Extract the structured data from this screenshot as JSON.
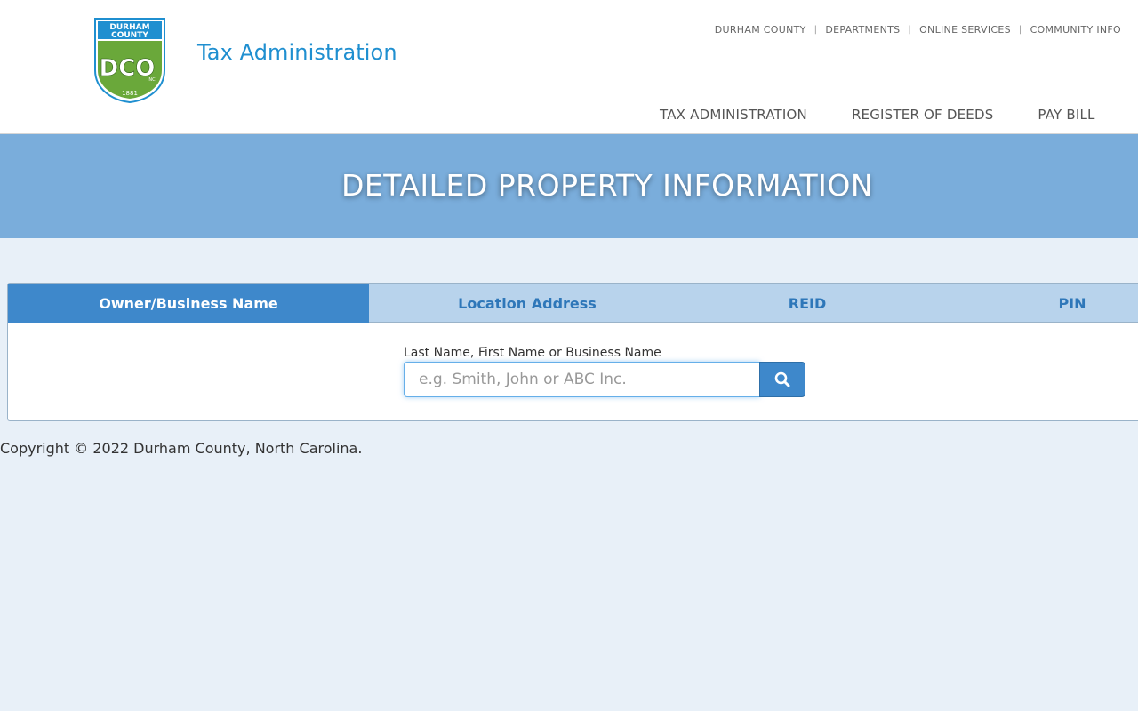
{
  "logo": {
    "county_text_line1": "DURHAM",
    "county_text_line2": "COUNTY",
    "monogram": "DCO",
    "state_abbrev": "NC",
    "year": "1881"
  },
  "site_title": "Tax Administration",
  "utility_nav": [
    "DURHAM COUNTY",
    "DEPARTMENTS",
    "ONLINE SERVICES",
    "COMMUNITY INFO"
  ],
  "main_nav": [
    "TAX ADMINISTRATION",
    "REGISTER OF DEEDS",
    "PAY BILL"
  ],
  "banner_title": "DETAILED PROPERTY INFORMATION",
  "tabs": [
    {
      "label": "Owner/Business Name",
      "active": true
    },
    {
      "label": "Location Address",
      "active": false
    },
    {
      "label": "REID",
      "active": false
    },
    {
      "label": "PIN",
      "active": false
    }
  ],
  "search": {
    "label": "Last Name, First Name or Business Name",
    "placeholder": "e.g. Smith, John or ABC Inc.",
    "value": "",
    "button_icon": "search-icon"
  },
  "footer": "Copyright © 2022 Durham County, North Carolina.",
  "colors": {
    "brand_blue": "#1f8fd0",
    "banner": "#7aaddb",
    "tab_active": "#3e88cb",
    "tab_inactive": "#b8d3ec",
    "page_bg": "#e8f0f8",
    "logo_green": "#6aa83a"
  }
}
